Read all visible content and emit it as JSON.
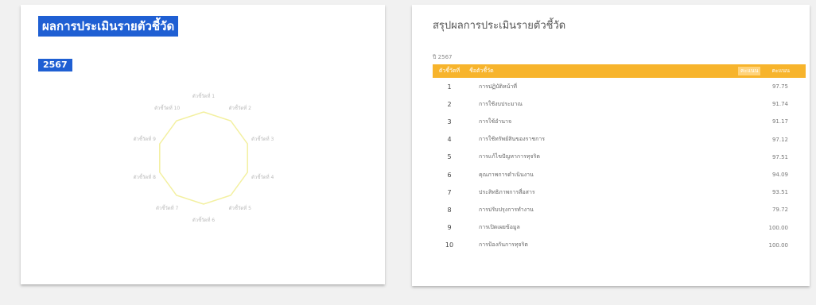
{
  "left_panel": {
    "title": "ผลการประเมินรายตัวชี้วัด",
    "year": "2567",
    "radar_labels": [
      "ตัวชี้วัดที่ 1",
      "ตัวชี้วัดที่ 2",
      "ตัวชี้วัดที่ 3",
      "ตัวชี้วัดที่ 4",
      "ตัวชี้วัดที่ 5",
      "ตัวชี้วัดที่ 6",
      "ตัวชี้วัดที่ 7",
      "ตัวชี้วัดที่ 8",
      "ตัวชี้วัดที่ 9",
      "ตัวชี้วัดที่ 10"
    ],
    "colors": {
      "title_bg": "#1f5fd3",
      "radar_line": "#f3f0a0"
    }
  },
  "right_panel": {
    "title": "สรุปผลการประเมินรายตัวชี้วัด",
    "caption": "ปี 2567",
    "table": {
      "headers": {
        "no": "ตัวชี้วัดที่",
        "name": "ชื่อตัวชี้วัด",
        "score_badge": "คะแนน",
        "score": "คะแนน"
      },
      "header_color": "#f7b42c",
      "rows": [
        {
          "no": "1",
          "name": "การปฏิบัติหน้าที่",
          "score": "97.75"
        },
        {
          "no": "2",
          "name": "การใช้งบประมาณ",
          "score": "91.74"
        },
        {
          "no": "3",
          "name": "การใช้อำนาจ",
          "score": "91.17"
        },
        {
          "no": "4",
          "name": "การใช้ทรัพย์สินของราชการ",
          "score": "97.12"
        },
        {
          "no": "5",
          "name": "การแก้ไขปัญหาการทุจริต",
          "score": "97.51"
        },
        {
          "no": "6",
          "name": "คุณภาพการดำเนินงาน",
          "score": "94.09"
        },
        {
          "no": "7",
          "name": "ประสิทธิภาพการสื่อสาร",
          "score": "93.51"
        },
        {
          "no": "8",
          "name": "การปรับปรุงการทำงาน",
          "score": "79.72"
        },
        {
          "no": "9",
          "name": "การเปิดเผยข้อมูล",
          "score": "100.00"
        },
        {
          "no": "10",
          "name": "การป้องกันการทุจริต",
          "score": "100.00"
        }
      ]
    }
  }
}
